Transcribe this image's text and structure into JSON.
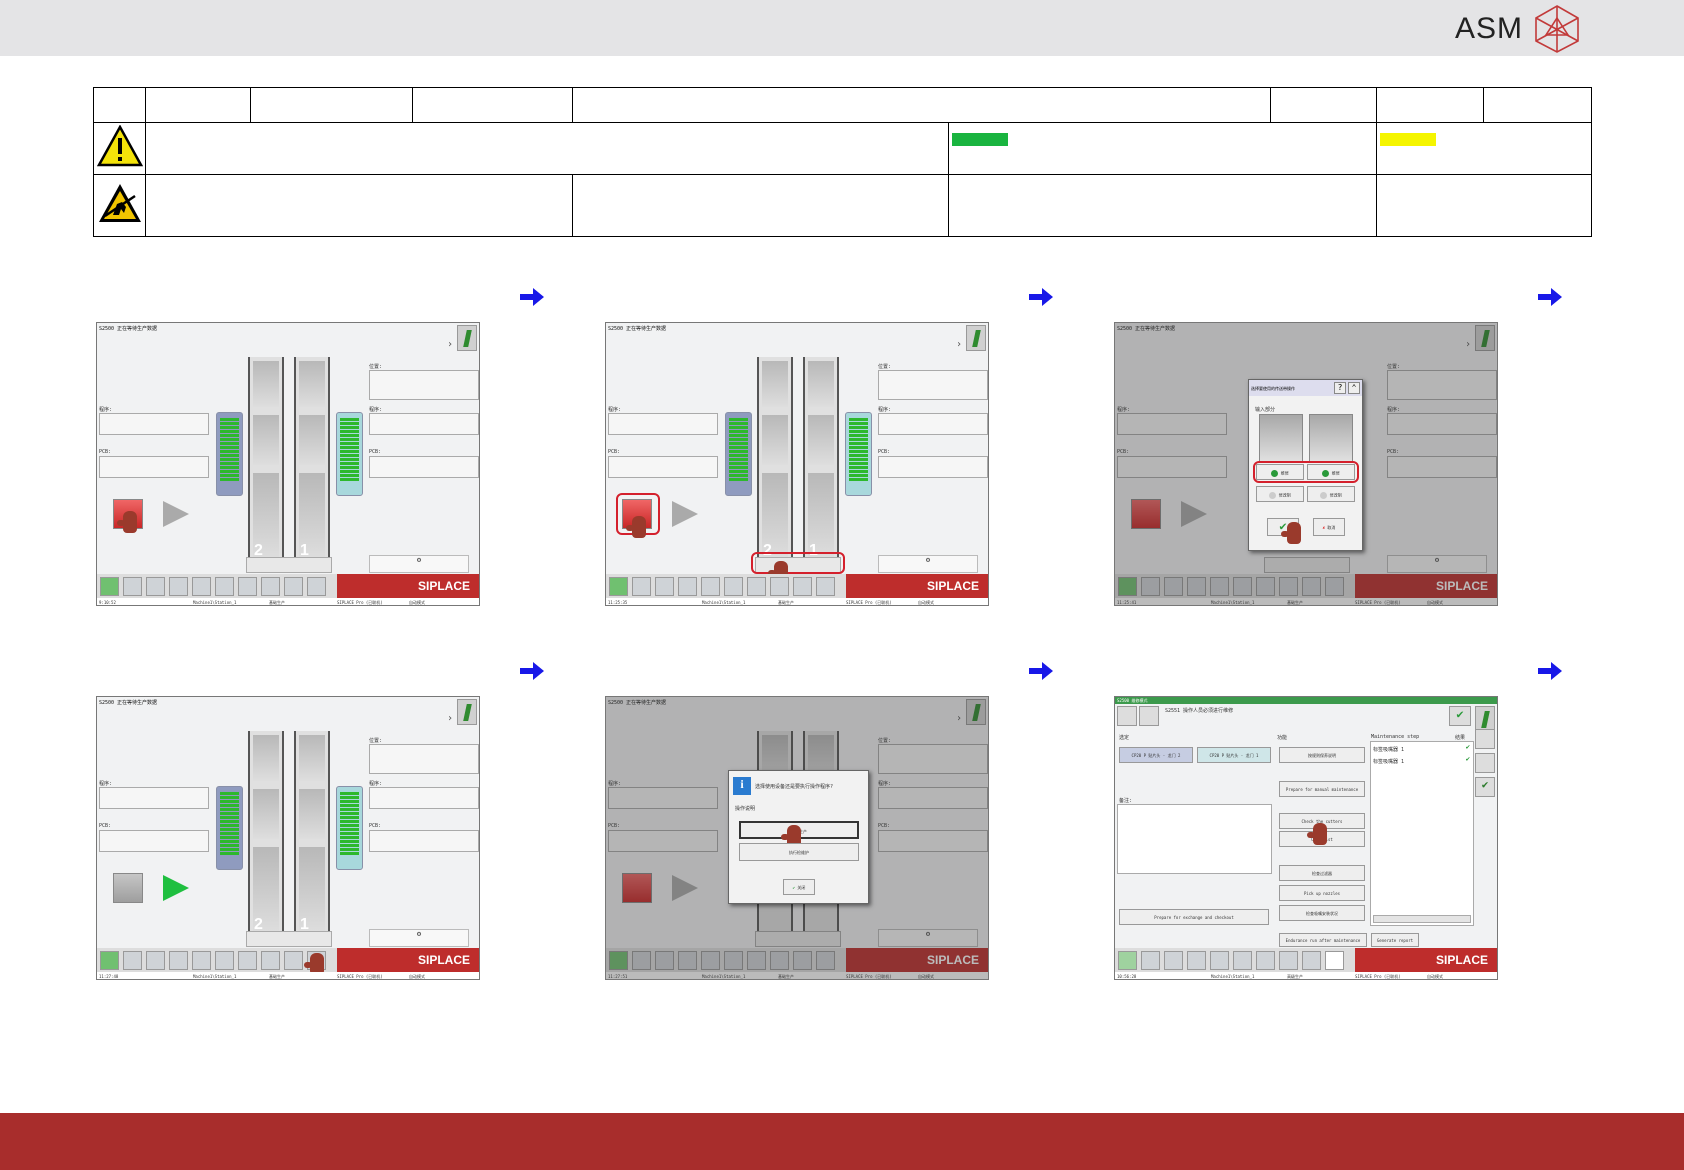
{
  "brand": {
    "name": "ASM"
  },
  "header_table": {
    "row1_cells": [
      "",
      "",
      "",
      "",
      "",
      "",
      "",
      ""
    ],
    "row2_text": "",
    "row2_green": "",
    "row2_yellow": "",
    "row3_cells": [
      "",
      "",
      "",
      ""
    ]
  },
  "colors": {
    "top_bar": "#e4e4e6",
    "bottom_bar": "#a82d2c",
    "accent_red": "#be2d2c",
    "ok_green": "#19b43f",
    "warn_yellow": "#f5f500",
    "arrow_blue": "#1818e8"
  },
  "icons": [
    "warning-triangle-icon",
    "esd-icon",
    "blue-arrow-icon",
    "info-icon"
  ],
  "screens": [
    {
      "title": "S2500 正在等待生产数据",
      "program_label": "程序:",
      "pcb_label": "PCB:",
      "position_label": "位置:",
      "lane_numbers": [
        "2",
        "1"
      ],
      "brand": "SIPLACE",
      "time": "9:10:52",
      "station": "Machine1\\Station_1",
      "mode1": "基础生产",
      "mode2": "SIPLACE Pro (已联机)",
      "mode3": "自动模式"
    },
    {
      "title": "S2500 正在等待生产数据",
      "program_label": "程序:",
      "pcb_label": "PCB:",
      "position_label": "位置:",
      "lane_numbers": [
        "2",
        "1"
      ],
      "brand": "SIPLACE",
      "time": "11:25:35",
      "station": "Machine1\\Station_1",
      "mode1": "基础生产",
      "mode2": "SIPLACE Pro (已联机)",
      "mode3": "自动模式"
    },
    {
      "title": "S2500 正在等待生产数据",
      "program_label": "程序:",
      "pcb_label": "PCB:",
      "position_label": "位置:",
      "brand": "SIPLACE",
      "time": "11:25:41",
      "station": "Machine1\\Station_1",
      "mode1": "基础生产",
      "mode2": "SIPLACE Pro (已联机)",
      "mode3": "自动模式",
      "dialog": {
        "title": "选择要使用的传送带操作",
        "section": "输入部分",
        "opt_a": "维修",
        "opt_b": "维修",
        "opt_c": "修改制",
        "opt_d": "修改制",
        "cancel": "取消"
      }
    },
    {
      "title": "S2500 正在等待生产数据",
      "program_label": "程序:",
      "pcb_label": "PCB:",
      "position_label": "位置:",
      "lane_numbers": [
        "2",
        "1"
      ],
      "brand": "SIPLACE",
      "time": "11:27:48",
      "station": "Machine1\\Station_1",
      "mode1": "基础生产",
      "mode2": "SIPLACE Pro (已联机)",
      "mode3": "自动模式"
    },
    {
      "title": "S2500 正在等待生产数据",
      "program_label": "程序:",
      "pcb_label": "PCB:",
      "position_label": "位置:",
      "brand": "SIPLACE",
      "time": "11:27:51",
      "station": "Machine1\\Station_1",
      "mode1": "基础生产",
      "mode2": "SIPLACE Pro (已联机)",
      "mode3": "自动模式",
      "dialog": {
        "title": "选择使用设备还是要执行操作程序?",
        "section": "操作说明",
        "btn1": "自动生产",
        "btn2": "执行检维护",
        "close": "关闭"
      }
    },
    {
      "title": "S2500 维修模式",
      "subtitle": "S2551 操作人员必须进行维修",
      "col_select": "选定",
      "col_function": "功能",
      "col_step": "Maintenance step",
      "col_result": "结果",
      "head1": "CP20 P 贴片头 - 龙门 2",
      "head2": "CP20 P 贴片头 - 龙门 1",
      "note": "备注:",
      "f1": "按规则保养说明",
      "f2": "Prepare for manual maintenance",
      "f3": "Check the cutters",
      "f4": "Checklist",
      "f5": "检查过滤器",
      "f6": "Pick up nozzles",
      "f7": "检查吸嘴安装状况",
      "left_btn": "Prepare for exchange and checkout",
      "b1": "Endurance run after maintenance",
      "b2": "Generate report",
      "s1": "标签吸嘴器 1",
      "s2": "标签吸嘴器 1",
      "brand": "SIPLACE",
      "time": "10:56:28",
      "station": "Machine1\\Station_1",
      "mode1": "高级生产",
      "mode2": "SIPLACE Pro (已联机)",
      "mode3": "自动模式"
    }
  ]
}
